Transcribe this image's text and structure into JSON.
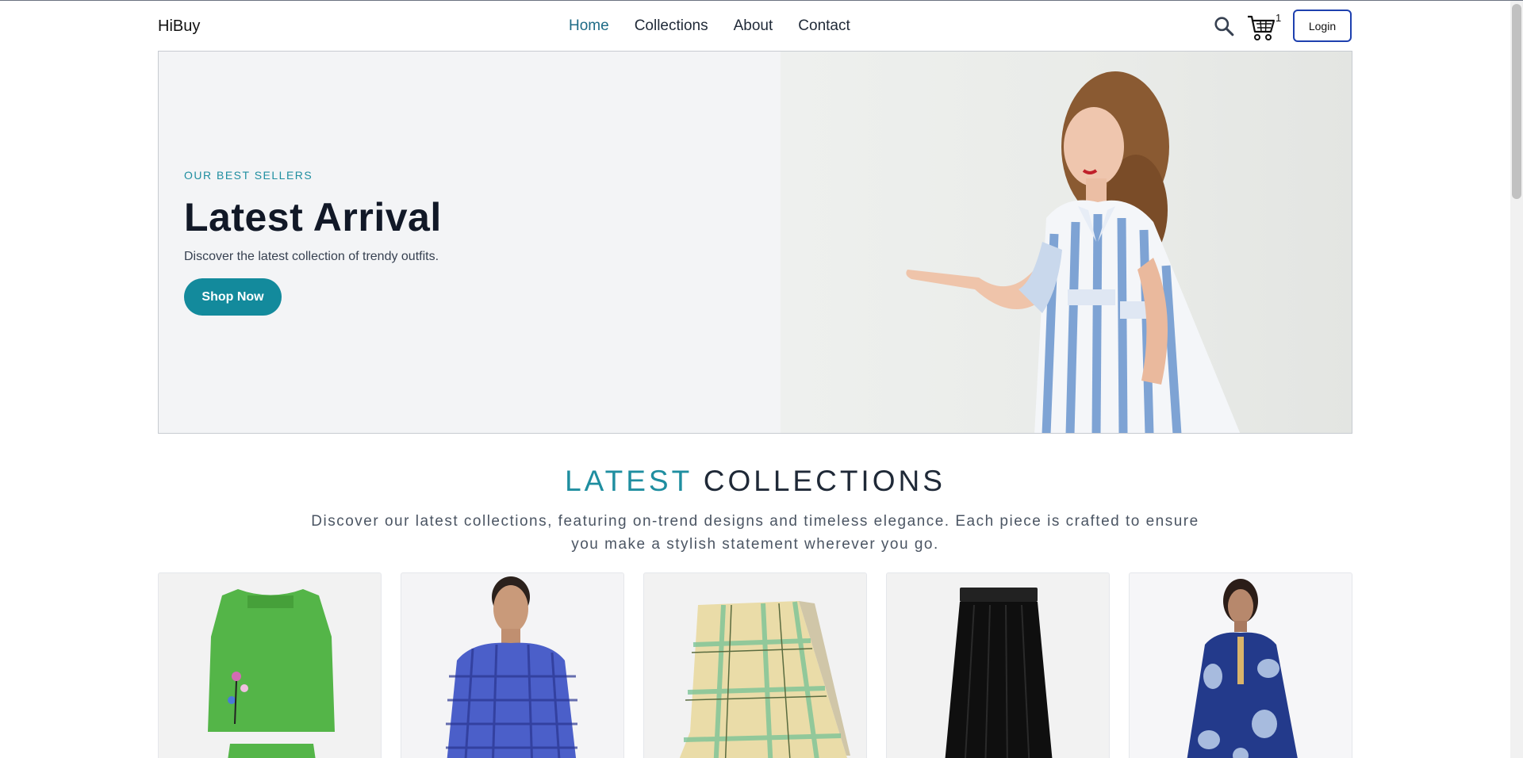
{
  "brand": "HiBuy",
  "nav": {
    "items": [
      {
        "label": "Home",
        "active": true
      },
      {
        "label": "Collections",
        "active": false
      },
      {
        "label": "About",
        "active": false
      },
      {
        "label": "Contact",
        "active": false
      }
    ],
    "cart_count": "1",
    "login_label": "Login"
  },
  "hero": {
    "eyebrow": "OUR BEST SELLERS",
    "title": "Latest Arrival",
    "subtitle": "Discover the latest collection of trendy outfits.",
    "cta_label": "Shop Now"
  },
  "collections": {
    "title_accent": "LATEST",
    "title_rest": "COLLECTIONS",
    "description": "Discover our latest collections, featuring on-trend designs and timeless elegance. Each piece is crafted to ensure you make a stylish statement wherever you go.",
    "products": [
      {
        "image": "green kids outfit"
      },
      {
        "image": "man in blue check shirt"
      },
      {
        "image": "plaid lungi"
      },
      {
        "image": "black skirt"
      },
      {
        "image": "woman in blue printed kurti"
      }
    ]
  },
  "colors": {
    "accent": "#138a9c",
    "login_border": "#1e40af",
    "nav_active": "#1e6b86"
  }
}
